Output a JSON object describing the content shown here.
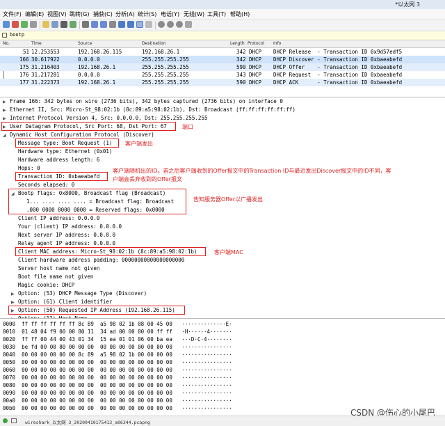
{
  "window": {
    "title": "*以太网 3"
  },
  "menu": [
    "文件(F)",
    "编辑(E)",
    "视图(V)",
    "跳转(G)",
    "捕获(C)",
    "分析(A)",
    "统计(S)",
    "电话(Y)",
    "无线(W)",
    "工具(T)",
    "帮助(H)"
  ],
  "filter": {
    "text": "bootp"
  },
  "packet_list": {
    "columns": [
      "No.",
      "Time",
      "Source",
      "Destination",
      "Length",
      "Protocol",
      "Info"
    ],
    "rows": [
      {
        "no": "51",
        "time": "12.253553",
        "src": "192.168.26.115",
        "dst": "192.168.26.1",
        "len": "342",
        "proto": "DHCP",
        "info": "DHCP Release  - Transaction ID 0x9d57edf5"
      },
      {
        "no": "166",
        "time": "30.617922",
        "src": "0.0.0.0",
        "dst": "255.255.255.255",
        "len": "342",
        "proto": "DHCP",
        "info": "DHCP Discover - Transaction ID 0xbaeabefd"
      },
      {
        "no": "175",
        "time": "31.216403",
        "src": "192.168.26.1",
        "dst": "255.255.255.255",
        "len": "590",
        "proto": "DHCP",
        "info": "DHCP Offer    - Transaction ID 0xbaeabefd"
      },
      {
        "no": "176",
        "time": "31.217281",
        "src": "0.0.0.0",
        "dst": "255.255.255.255",
        "len": "343",
        "proto": "DHCP",
        "info": "DHCP Request  - Transaction ID 0xbaeabefd"
      },
      {
        "no": "177",
        "time": "31.222373",
        "src": "192.168.26.1",
        "dst": "255.255.255.255",
        "len": "590",
        "proto": "DHCP",
        "info": "DHCP ACK      - Transaction ID 0xbaeabefd"
      }
    ]
  },
  "details": [
    "Frame 166: 342 bytes on wire (2736 bits), 342 bytes captured (2736 bits) on interface 0",
    "Ethernet II, Src: Micro-St_98:02:1b (8c:89:a5:98:02:1b), Dst: Broadcast (ff:ff:ff:ff:ff:ff)",
    "Internet Protocol Version 4, Src: 0.0.0.0, Dst: 255.255.255.255",
    "User Datagram Protocol, Src Port: 68, Dst Port: 67",
    "Dynamic Host Configuration Protocol (Discover)",
    "Message type: Boot Request (1)",
    "Hardware type: Ethernet (0x01)",
    "Hardware address length: 6",
    "Hops: 0",
    "Transaction ID: 0xbaeabefd",
    "Seconds elapsed: 0",
    "Bootp flags: 0x8000, Broadcast flag (Broadcast)",
    "1... .... .... .... = Broadcast flag: Broadcast",
    ".000 0000 0000 0000 = Reserved flags: 0x0000",
    "Client IP address: 0.0.0.0",
    "Your (client) IP address: 0.0.0.0",
    "Next server IP address: 0.0.0.0",
    "Relay agent IP address: 0.0.0.0",
    "Client MAC address: Micro-St_98:02:1b (8c:89:a5:98:02:1b)",
    "Client hardware address padding: 00000000000000000000",
    "Server host name not given",
    "Boot file name not given",
    "Magic cookie: DHCP",
    "Option: (53) DHCP Message Type (Discover)",
    "Option: (61) Client identifier",
    "Option: (50) Requested IP Address (192.168.26.115)",
    "Option: (12) Host Name"
  ],
  "annotations": {
    "port": "端口",
    "client_send": "客户端发出",
    "txid_line1": "客户端随机出的ID。若之后客户端收到的Offer报文中的Transaction ID与最近发出Discover报文中的ID不同，客",
    "txid_line2": "户端会丢弃收到的Offer报文",
    "broadcast": "告知服务器Offer以广播发出",
    "mac": "客户端MAC"
  },
  "bytes": [
    {
      "off": "0000",
      "hex": "ff ff ff ff ff ff 8c 89  a5 98 02 1b 08 00 45 00",
      "ascii": "··············E·"
    },
    {
      "off": "0010",
      "hex": "01 48 04 f9 00 00 80 11  34 ad 00 00 00 00 ff ff",
      "ascii": "·H······4·······"
    },
    {
      "off": "0020",
      "hex": "ff ff 00 44 00 43 01 34  15 ea 01 01 06 00 ba ea",
      "ascii": "···D·C·4········"
    },
    {
      "off": "0030",
      "hex": "be fd 00 00 80 00 00 00  00 00 00 00 00 00 00 00",
      "ascii": "················"
    },
    {
      "off": "0040",
      "hex": "00 00 00 00 00 00 8c 89  a5 98 02 1b 00 00 00 00",
      "ascii": "················"
    },
    {
      "off": "0050",
      "hex": "00 00 00 00 00 00 00 00  00 00 00 00 00 00 00 00",
      "ascii": "················"
    },
    {
      "off": "0060",
      "hex": "00 00 00 00 00 00 00 00  00 00 00 00 00 00 00 00",
      "ascii": "················"
    },
    {
      "off": "0070",
      "hex": "00 00 00 00 00 00 00 00  00 00 00 00 00 00 00 00",
      "ascii": "················"
    },
    {
      "off": "0080",
      "hex": "00 00 00 00 00 00 00 00  00 00 00 00 00 00 00 00",
      "ascii": "················"
    },
    {
      "off": "0090",
      "hex": "00 00 00 00 00 00 00 00  00 00 00 00 00 00 00 00",
      "ascii": "················"
    },
    {
      "off": "00a0",
      "hex": "00 00 00 00 00 00 00 00  00 00 00 00 00 00 00 00",
      "ascii": "················"
    },
    {
      "off": "00b0",
      "hex": "00 00 00 00 00 00 00 00  00 00 00 00 00 00 00 00",
      "ascii": "················"
    }
  ],
  "status": {
    "file": "wireshark_以太网 3_20200410175413_a06344.pcapng"
  },
  "watermark": "CSDN @伤心的小尾巴",
  "colors": {
    "selection": "#cfe3fb",
    "annotation": "#e01f1f",
    "filter_bg": "#fffde0"
  }
}
